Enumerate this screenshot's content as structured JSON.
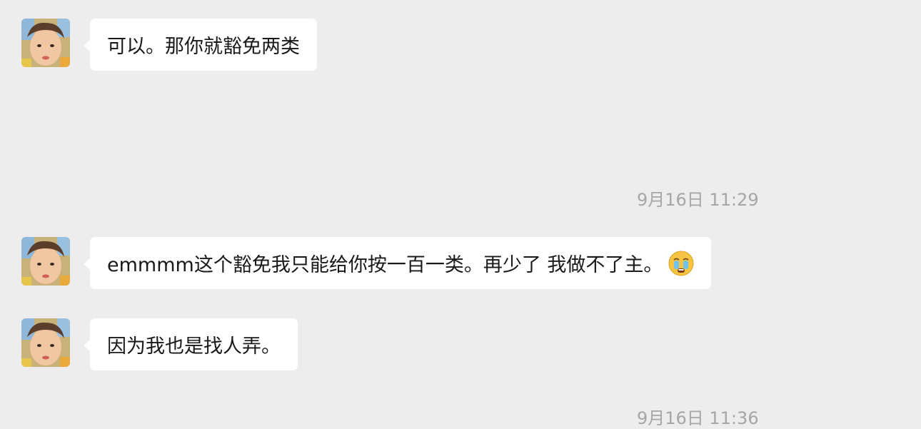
{
  "messages": [
    {
      "text": "可以。那你就豁免两类"
    },
    {
      "text": "emmmm这个豁免我只能给你按一百一类。再少了 我做不了主。",
      "trailing_icon": "crying-face-emoji"
    },
    {
      "text": "因为我也是找人弄。"
    }
  ],
  "timestamps": [
    {
      "text": "9月16日 11:29"
    },
    {
      "text": "9月16日 11:36"
    }
  ],
  "colors": {
    "background": "#ededed",
    "bubble": "#ffffff",
    "timestamp": "#a6a6a6",
    "text": "#191919"
  }
}
